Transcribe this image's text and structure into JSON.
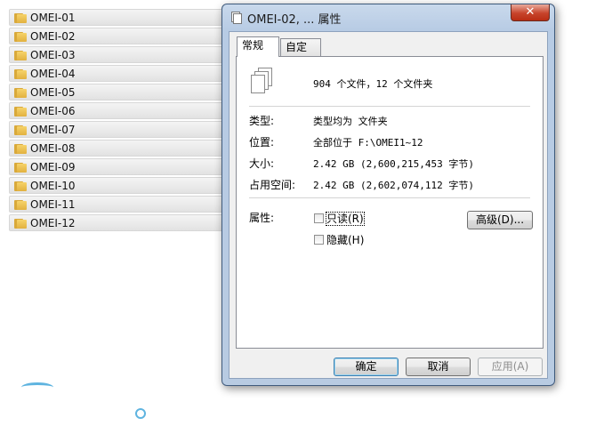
{
  "explorer": {
    "folders": [
      "OMEI-01",
      "OMEI-02",
      "OMEI-03",
      "OMEI-04",
      "OMEI-05",
      "OMEI-06",
      "OMEI-07",
      "OMEI-08",
      "OMEI-09",
      "OMEI-10",
      "OMEI-11",
      "OMEI-12"
    ]
  },
  "dialog": {
    "title": "OMEI-02, ... 属性",
    "close_icon": "✕",
    "tabs": [
      "常规",
      "自定义"
    ],
    "summary": "904 个文件，12 个文件夹",
    "fields": {
      "type_label": "类型:",
      "type_value": "类型均为 文件夹",
      "location_label": "位置:",
      "location_value": "全部位于 F:\\OMEI1~12",
      "size_label": "大小:",
      "size_value": "2.42 GB (2,600,215,453 字节)",
      "disk_label": "占用空间:",
      "disk_value": "2.42 GB (2,602,074,112 字节)",
      "attributes_label": "属性:"
    },
    "attributes": {
      "readonly_label": "只读(R)",
      "hidden_label": "隐藏(H)",
      "readonly_checked": false,
      "hidden_checked": false
    },
    "buttons": {
      "advanced": "高级(D)...",
      "ok": "确定",
      "cancel": "取消",
      "apply": "应用(A)"
    }
  },
  "colors": {
    "folder_icon": "#e2b13f",
    "close_button": "#c7442b",
    "accent_decor": "#5fb4e0"
  }
}
